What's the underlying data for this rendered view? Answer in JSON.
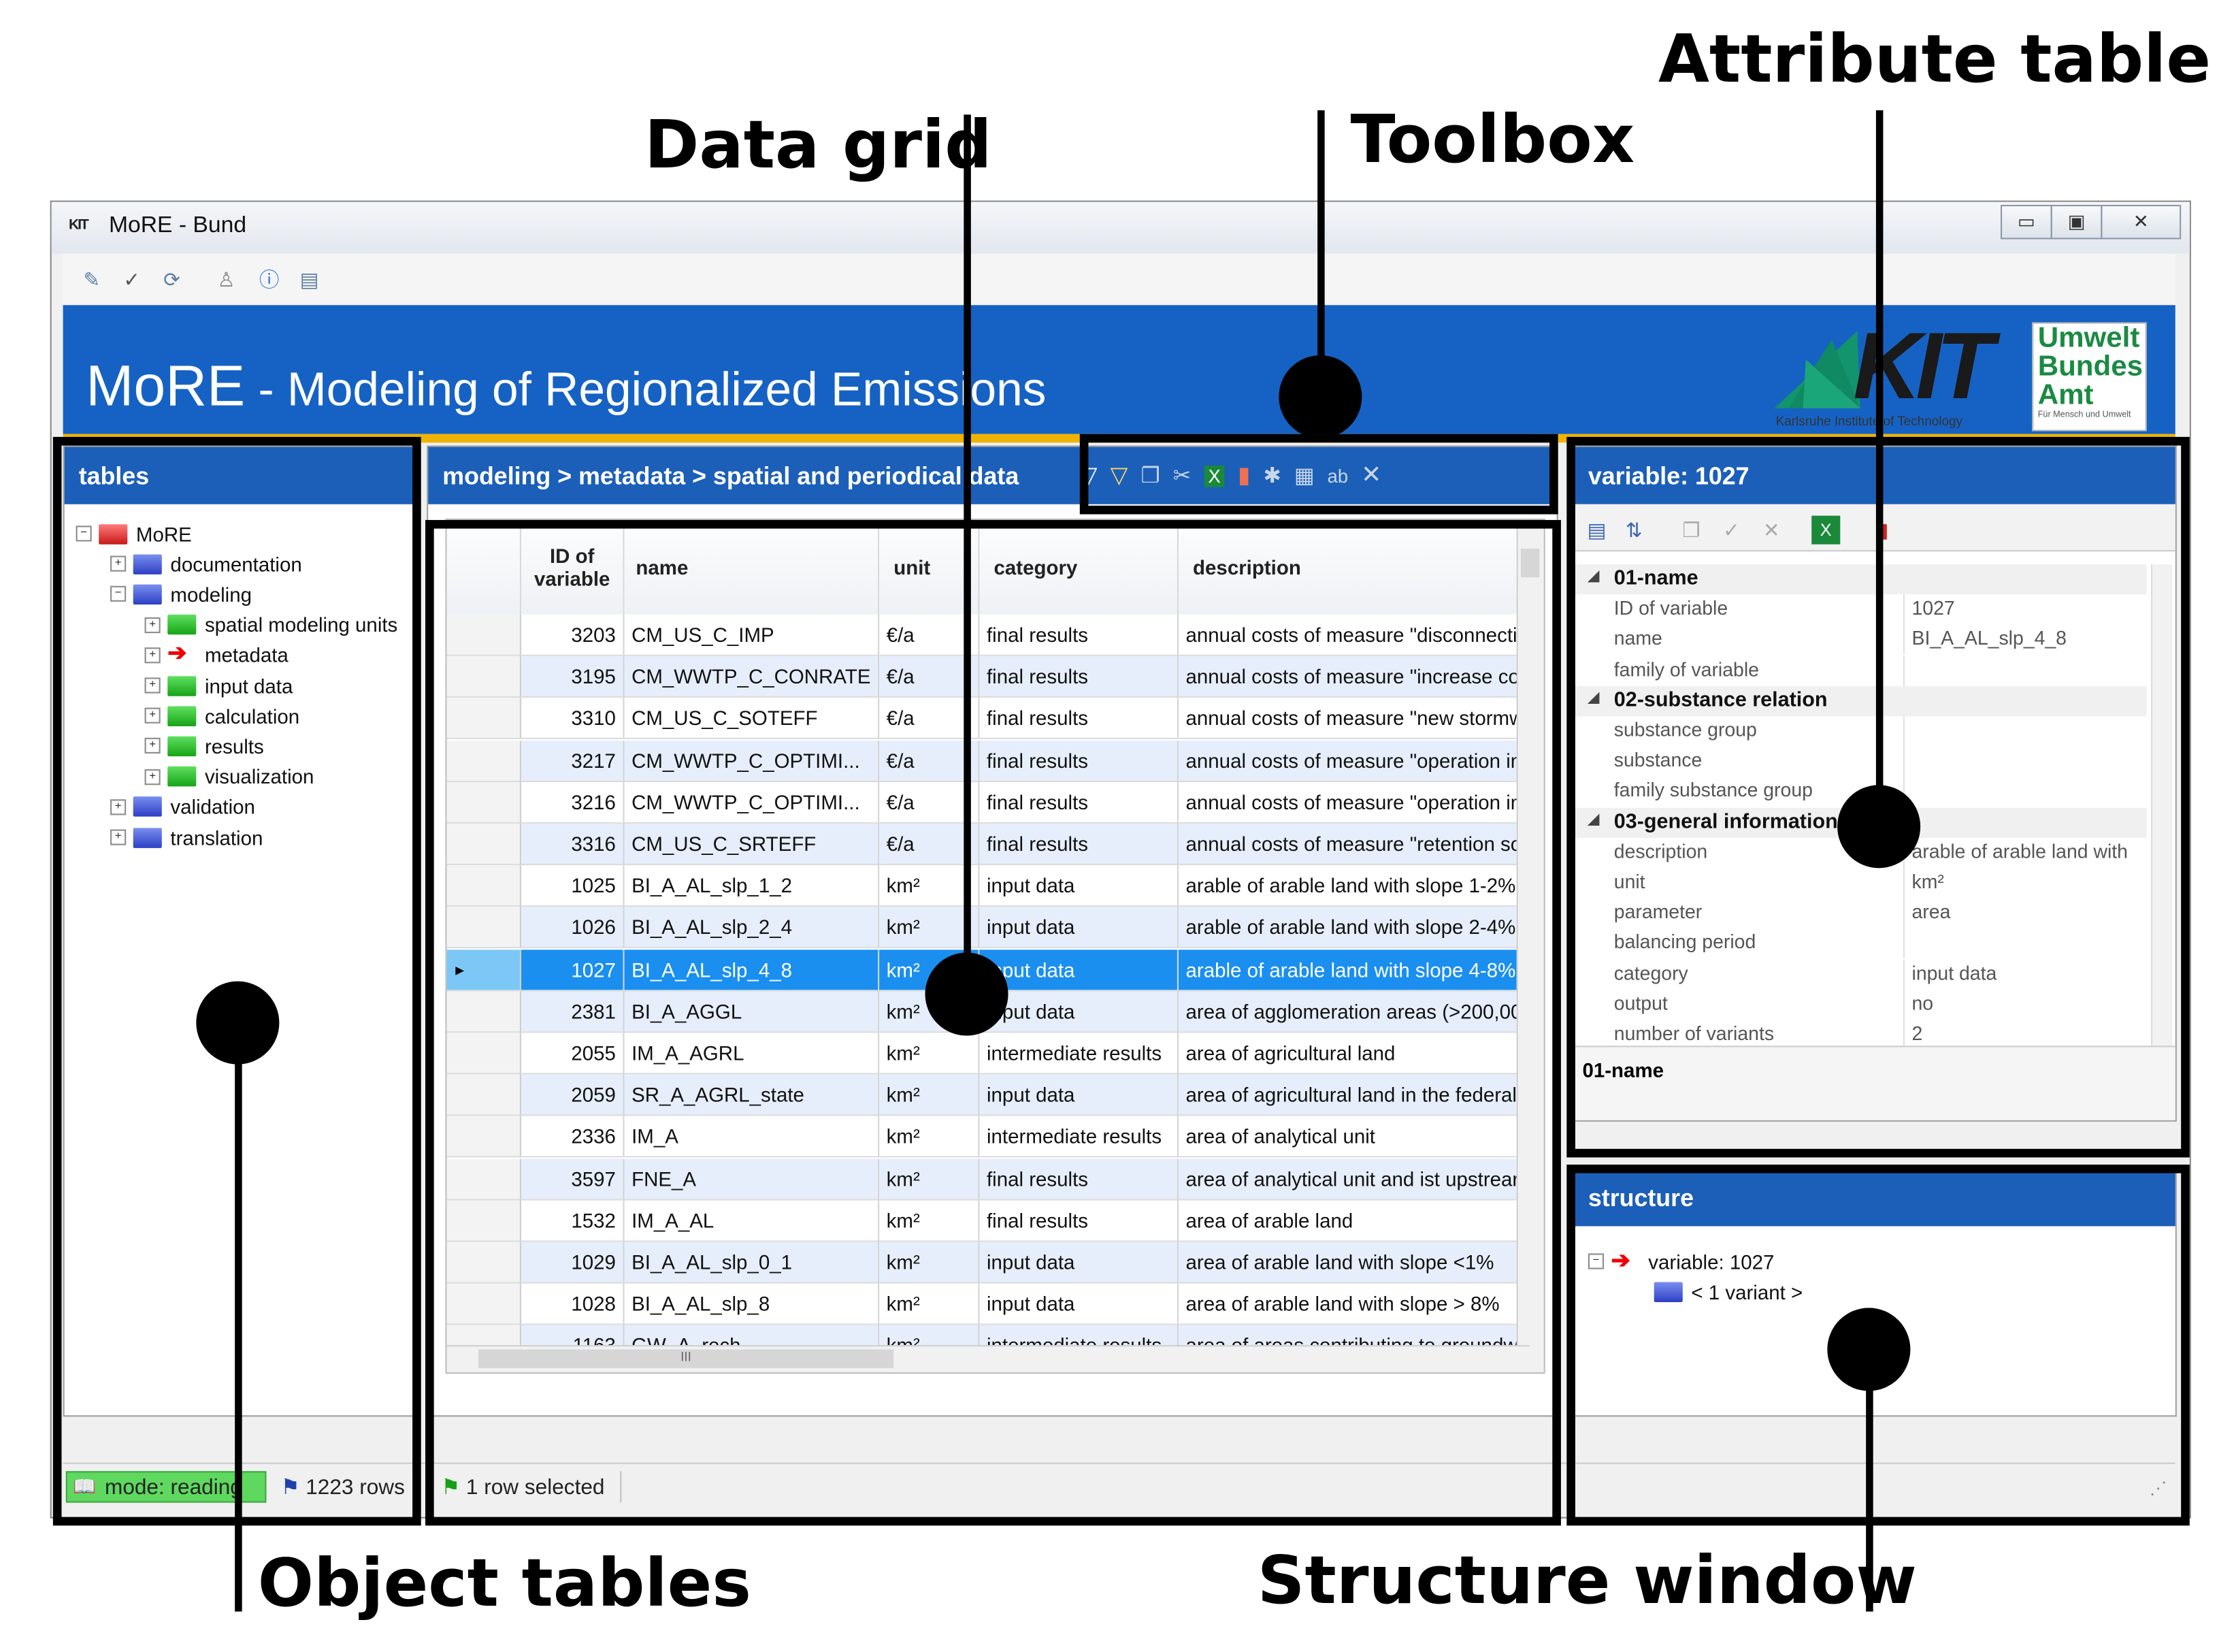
{
  "callouts": {
    "data_grid": "Data grid",
    "toolbox": "Toolbox",
    "attribute_table": "Attribute table",
    "object_tables": "Object tables",
    "structure_window": "Structure window"
  },
  "window": {
    "logo_text": "KIT",
    "title": "MoRE - Bund",
    "min_label": "▭",
    "max_label": "▣",
    "close_label": "✕"
  },
  "banner": {
    "title_big": "MoRE",
    "title_rest": " - Modeling of Regionalized Emissions",
    "kit_word": "KIT",
    "kit_sub": "Karlsruhe Institute of Technology",
    "uba_lines": [
      "Umwelt",
      "Bundes",
      "Amt"
    ],
    "uba_sub": "Für Mensch und Umwelt"
  },
  "tables_panel": {
    "header": "tables",
    "tree": [
      {
        "label": "MoRE",
        "exp": "−",
        "icon": "red"
      },
      {
        "label": "documentation",
        "exp": "+",
        "icon": "blue"
      },
      {
        "label": "modeling",
        "exp": "−",
        "icon": "blue"
      },
      {
        "label": "spatial modeling units",
        "exp": "+",
        "icon": "green"
      },
      {
        "label": "metadata",
        "exp": "+",
        "icon": "arrow"
      },
      {
        "label": "input data",
        "exp": "+",
        "icon": "green"
      },
      {
        "label": "calculation",
        "exp": "+",
        "icon": "green"
      },
      {
        "label": "results",
        "exp": "+",
        "icon": "green"
      },
      {
        "label": "visualization",
        "exp": "+",
        "icon": "green"
      },
      {
        "label": "validation",
        "exp": "+",
        "icon": "blue"
      },
      {
        "label": "translation",
        "exp": "+",
        "icon": "blue"
      }
    ]
  },
  "grid_panel": {
    "breadcrumb": "modeling > metadata > spatial and periodical data",
    "columns": [
      "ID of variable",
      "name",
      "unit",
      "category",
      "description"
    ],
    "rows": [
      [
        "3203",
        "CM_US_C_IMP",
        "€/a",
        "final results",
        "annual costs of measure \"disconnectio"
      ],
      [
        "3195",
        "CM_WWTP_C_CONRATE",
        "€/a",
        "final results",
        "annual costs of measure \"increase cor"
      ],
      [
        "3310",
        "CM_US_C_SOTEFF",
        "€/a",
        "final results",
        "annual costs of measure \"new stormw"
      ],
      [
        "3217",
        "CM_WWTP_C_OPTIMI...",
        "€/a",
        "final results",
        "annual costs of measure \"operation im"
      ],
      [
        "3216",
        "CM_WWTP_C_OPTIMI...",
        "€/a",
        "final results",
        "annual costs of measure \"operation im"
      ],
      [
        "3316",
        "CM_US_C_SRTEFF",
        "€/a",
        "final results",
        "annual costs of measure \"retention so"
      ],
      [
        "1025",
        "BI_A_AL_slp_1_2",
        "km²",
        "input data",
        "arable of arable land with slope 1-2%"
      ],
      [
        "1026",
        "BI_A_AL_slp_2_4",
        "km²",
        "input data",
        "arable of arable land with slope 2-4%"
      ],
      [
        "1027",
        "BI_A_AL_slp_4_8",
        "km²",
        "input data",
        "arable of arable land with slope 4-8%"
      ],
      [
        "2381",
        "BI_A_AGGL",
        "km²",
        "input data",
        "area of agglomeration areas (>200,00"
      ],
      [
        "2055",
        "IM_A_AGRL",
        "km²",
        "intermediate results",
        "area of agricultural land"
      ],
      [
        "2059",
        "SR_A_AGRL_state",
        "km²",
        "input data",
        "area of agricultural land in the federal"
      ],
      [
        "2336",
        "IM_A",
        "km²",
        "intermediate results",
        "area of analytical unit"
      ],
      [
        "3597",
        "FNE_A",
        "km²",
        "final results",
        "area of analytical unit and ist upstrear"
      ],
      [
        "1532",
        "IM_A_AL",
        "km²",
        "final results",
        "area of arable land"
      ],
      [
        "1029",
        "BI_A_AL_slp_0_1",
        "km²",
        "input data",
        "area of arable land with slope <1%"
      ],
      [
        "1028",
        "BI_A_AL_slp_8",
        "km²",
        "input data",
        "area of arable land with slope > 8%"
      ],
      [
        "1163",
        "GW_A_rech",
        "km²",
        "intermediate results",
        "area of areas contributing to groundw"
      ]
    ],
    "hscroll_grip": "III"
  },
  "attr_panel": {
    "header": "variable: 1027",
    "rows": [
      {
        "type": "cat",
        "k": "01-name"
      },
      {
        "type": "item",
        "k": "ID of variable",
        "v": "1027"
      },
      {
        "type": "item",
        "k": "name",
        "v": "BI_A_AL_slp_4_8"
      },
      {
        "type": "item",
        "k": "family of variable",
        "v": ""
      },
      {
        "type": "cat",
        "k": "02-substance relation"
      },
      {
        "type": "item",
        "k": "substance group",
        "v": ""
      },
      {
        "type": "item",
        "k": "substance",
        "v": ""
      },
      {
        "type": "item",
        "k": "family substance group",
        "v": ""
      },
      {
        "type": "cat",
        "k": "03-general information"
      },
      {
        "type": "item",
        "k": "description",
        "v": "arable of arable land with"
      },
      {
        "type": "item",
        "k": "unit",
        "v": "km²"
      },
      {
        "type": "item",
        "k": "parameter",
        "v": "area"
      },
      {
        "type": "item",
        "k": "balancing period",
        "v": ""
      },
      {
        "type": "item",
        "k": "category",
        "v": "input data"
      },
      {
        "type": "item",
        "k": "output",
        "v": "no"
      },
      {
        "type": "item",
        "k": "number of variants",
        "v": "2"
      },
      {
        "type": "item",
        "k": "remarks",
        "v": ""
      }
    ],
    "footer": "01-name"
  },
  "struct_panel": {
    "header": "structure",
    "root": "variable: 1027",
    "child": "< 1 variant >"
  },
  "statusbar": {
    "mode": "mode: reading",
    "rows": "1223 rows",
    "selected": "1 row selected"
  },
  "colors": {
    "accent_blue": "#1c5fb8",
    "banner_blue": "#1662c4",
    "selection": "#1a8ff0",
    "highlight_yellow": "#f0b400",
    "uba_green": "#1b8a43"
  }
}
